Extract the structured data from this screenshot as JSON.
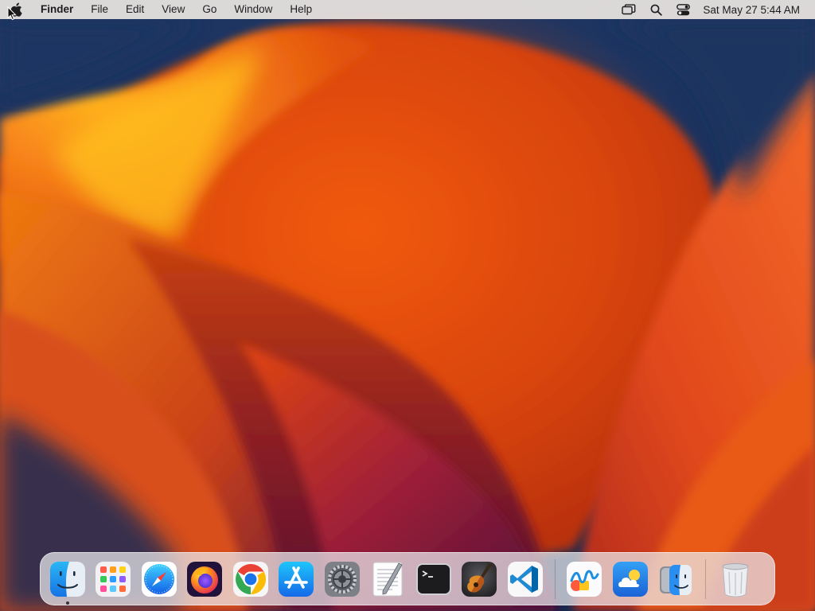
{
  "menubar": {
    "apple_icon": "apple-logo-icon",
    "app_name": "Finder",
    "items": [
      "File",
      "Edit",
      "View",
      "Go",
      "Window",
      "Help"
    ],
    "status_icons": [
      "screen-mirroring-icon",
      "spotlight-search-icon",
      "control-center-icon"
    ],
    "clock": "Sat May 27  5:44 AM"
  },
  "dock": {
    "apps": [
      {
        "name": "Finder",
        "icon": "finder-icon",
        "running": true
      },
      {
        "name": "Launchpad",
        "icon": "launchpad-icon",
        "running": false
      },
      {
        "name": "Safari",
        "icon": "safari-icon",
        "running": false
      },
      {
        "name": "Firefox",
        "icon": "firefox-icon",
        "running": false
      },
      {
        "name": "Google Chrome",
        "icon": "chrome-icon",
        "running": false
      },
      {
        "name": "App Store",
        "icon": "app-store-icon",
        "running": false
      },
      {
        "name": "System Settings",
        "icon": "system-settings-icon",
        "running": false
      },
      {
        "name": "TextEdit",
        "icon": "textedit-icon",
        "running": false
      },
      {
        "name": "Terminal",
        "icon": "terminal-icon",
        "running": false
      },
      {
        "name": "GarageBand",
        "icon": "garageband-icon",
        "running": false
      },
      {
        "name": "Visual Studio Code",
        "icon": "vscode-icon",
        "running": false
      }
    ],
    "recents": [
      {
        "name": "Freeform",
        "icon": "freeform-icon"
      },
      {
        "name": "Weather",
        "icon": "weather-icon"
      },
      {
        "name": "Migration Assistant",
        "icon": "migration-assistant-icon"
      }
    ],
    "trash": {
      "name": "Trash",
      "icon": "trash-icon"
    }
  },
  "colors": {
    "wallpaper_orange": "#f26a10",
    "wallpaper_navy": "#1b2f55",
    "wallpaper_magenta": "#7a1a3a"
  }
}
